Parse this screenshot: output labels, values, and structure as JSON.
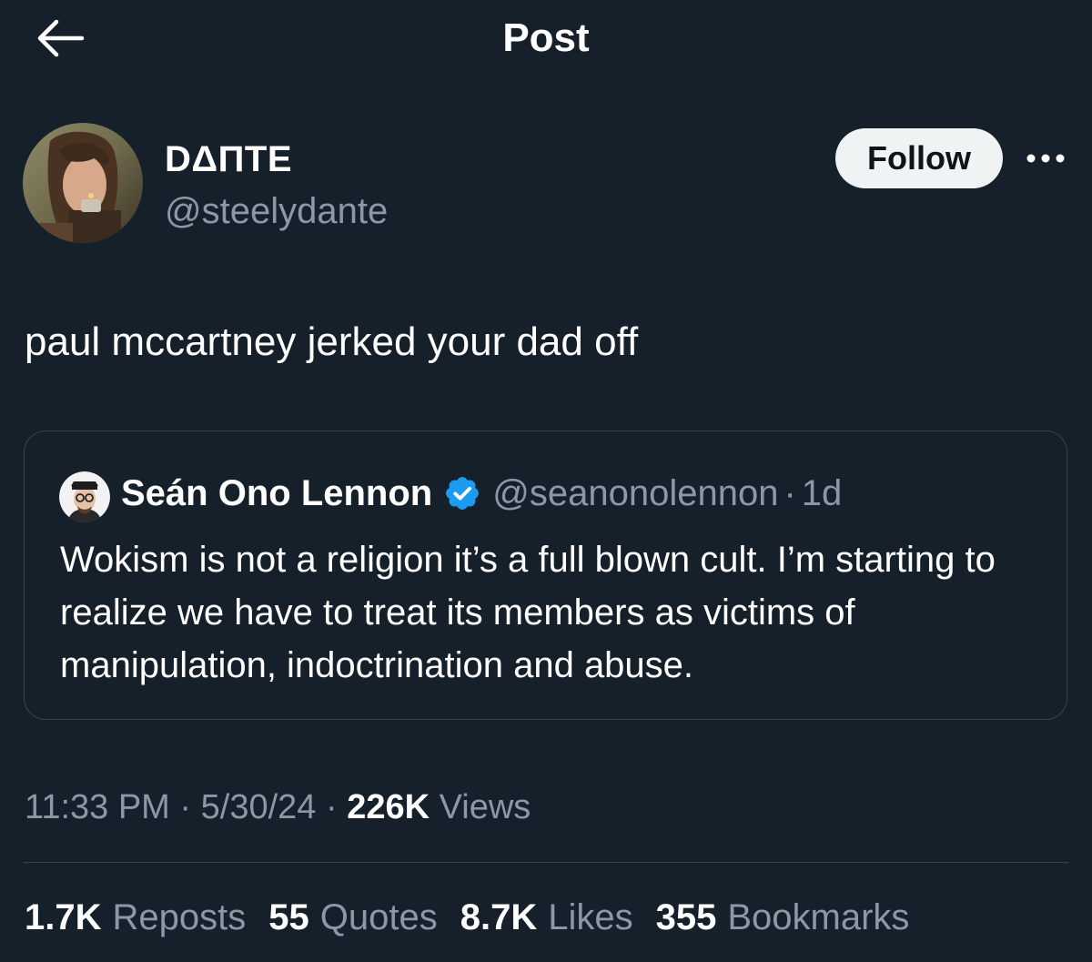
{
  "header": {
    "title": "Post",
    "back_icon": "arrow-left-icon"
  },
  "author": {
    "display_name": "DΔПTE",
    "handle": "@steelydante",
    "follow_label": "Follow",
    "more_icon": "more-horizontal-icon"
  },
  "post": {
    "text": "paul mccartney jerked your dad off"
  },
  "quote": {
    "name": "Seán Ono Lennon",
    "verified_icon": "verified-badge-icon",
    "verified_color": "#1d9bf0",
    "handle": "@seanonolennon",
    "separator": "·",
    "time": "1d",
    "text": "Wokism is not a religion it’s a full blown cult. I’m starting to realize we have to treat its members as victims of manipulation, indoctrination and abuse."
  },
  "meta": {
    "time": "11:33 PM",
    "separator": "·",
    "date": "5/30/24",
    "views_count": "226K",
    "views_label": "Views"
  },
  "stats": {
    "reposts": {
      "count": "1.7K",
      "label": "Reposts"
    },
    "quotes": {
      "count": "55",
      "label": "Quotes"
    },
    "likes": {
      "count": "8.7K",
      "label": "Likes"
    },
    "bookmarks": {
      "count": "355",
      "label": "Bookmarks"
    }
  },
  "colors": {
    "background": "#15202b",
    "secondary_text": "#8b98a5",
    "border": "#38444d",
    "follow_bg": "#eff3f4"
  }
}
